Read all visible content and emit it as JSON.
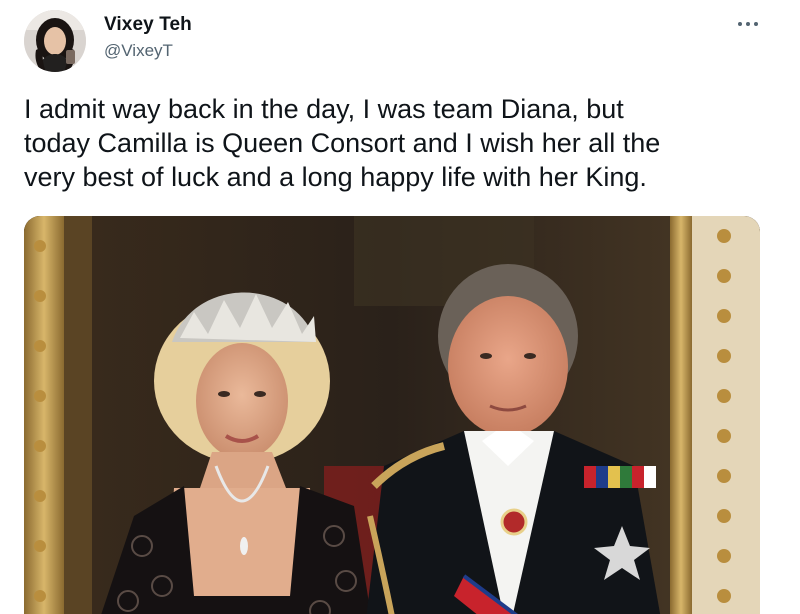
{
  "author": {
    "display_name": "Vixey Teh",
    "handle": "@VixeyT",
    "avatar_icon": "profile-photo"
  },
  "tweet": {
    "text_lines": [
      "I admit way back in the day, I was team Diana, but",
      "today Camilla is Queen Consort and I wish her all the",
      "very best of luck and a long happy life with her King."
    ]
  },
  "menu": {
    "icon": "more-horizontal-icon"
  },
  "media": {
    "type": "photo",
    "accent_colors": {
      "background": "#2a2118",
      "gold_frame": "#c9a45a",
      "uniform": "#111418",
      "sash": "#c8232c"
    }
  },
  "colors": {
    "text_primary": "#0f1419",
    "text_secondary": "#536471"
  }
}
